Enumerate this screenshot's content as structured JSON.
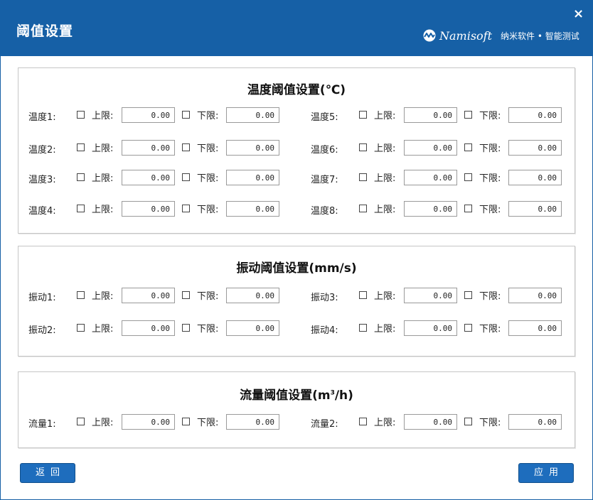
{
  "window": {
    "title": "阈值设置",
    "close_glyph": "×"
  },
  "brand": {
    "logo_icon": "namisoft-logo-icon",
    "name": "Namisoft",
    "tagline": "纳米软件 • 智能测试"
  },
  "labels": {
    "upper": "上限:",
    "lower": "下限:"
  },
  "sections": {
    "temperature": {
      "title": "温度阈值设置(℃)",
      "rows": [
        {
          "label": "温度1:",
          "upper": "0.00",
          "lower": "0.00"
        },
        {
          "label": "温度2:",
          "upper": "0.00",
          "lower": "0.00"
        },
        {
          "label": "温度3:",
          "upper": "0.00",
          "lower": "0.00"
        },
        {
          "label": "温度4:",
          "upper": "0.00",
          "lower": "0.00"
        },
        {
          "label": "温度5:",
          "upper": "0.00",
          "lower": "0.00"
        },
        {
          "label": "温度6:",
          "upper": "0.00",
          "lower": "0.00"
        },
        {
          "label": "温度7:",
          "upper": "0.00",
          "lower": "0.00"
        },
        {
          "label": "温度8:",
          "upper": "0.00",
          "lower": "0.00"
        }
      ]
    },
    "vibration": {
      "title": "振动阈值设置(mm/s)",
      "rows": [
        {
          "label": "振动1:",
          "upper": "0.00",
          "lower": "0.00"
        },
        {
          "label": "振动2:",
          "upper": "0.00",
          "lower": "0.00"
        },
        {
          "label": "振动3:",
          "upper": "0.00",
          "lower": "0.00"
        },
        {
          "label": "振动4:",
          "upper": "0.00",
          "lower": "0.00"
        }
      ]
    },
    "flow": {
      "title_main": "流量阈值设置(m",
      "title_sup": "3",
      "title_end": "/h)",
      "rows": [
        {
          "label": "流量1:",
          "upper": "0.00",
          "lower": "0.00"
        },
        {
          "label": "流量2:",
          "upper": "0.00",
          "lower": "0.00"
        }
      ]
    }
  },
  "buttons": {
    "back": "返回",
    "apply": "应用"
  },
  "colors": {
    "titlebar": "#1660a6",
    "button": "#1e6dbd",
    "panel_border": "#c6c6c6"
  }
}
